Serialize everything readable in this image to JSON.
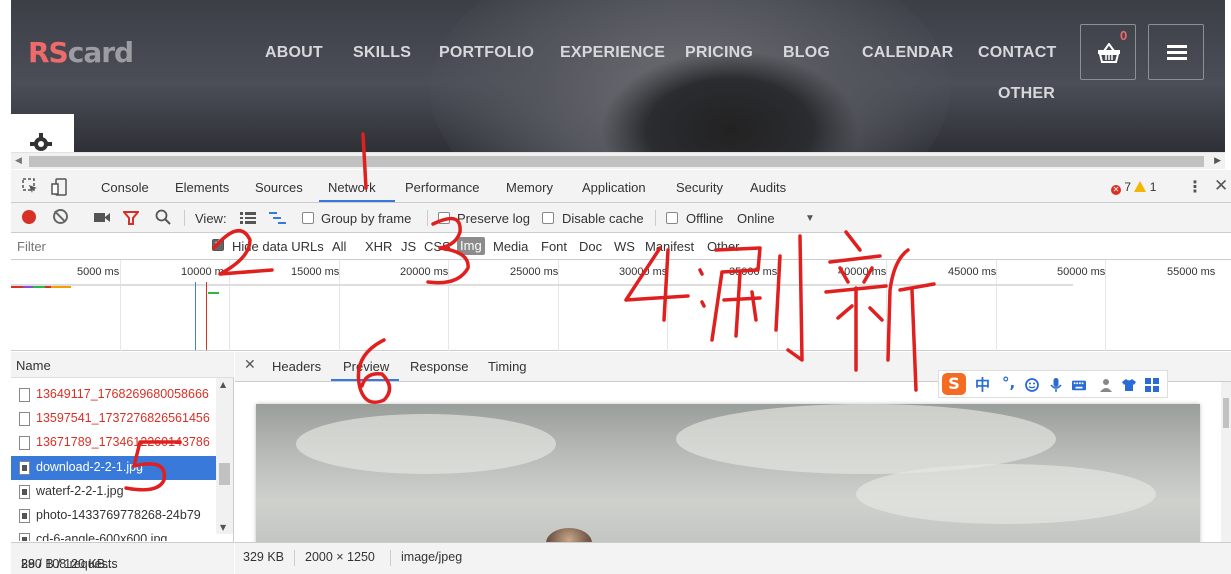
{
  "site": {
    "logo_rs": "RS",
    "logo_card": "card",
    "nav": [
      "ABOUT",
      "SKILLS",
      "PORTFOLIO",
      "EXPERIENCE",
      "PRICING",
      "BLOG",
      "CALENDAR",
      "CONTACT"
    ],
    "nav_other": "OTHER",
    "cart_count": "0",
    "icons": {
      "cart": "basket-icon",
      "menu": "hamburger-menu-icon",
      "settings": "gear-icon"
    }
  },
  "devtools": {
    "tabs": [
      "Console",
      "Elements",
      "Sources",
      "Network",
      "Performance",
      "Memory",
      "Application",
      "Security",
      "Audits"
    ],
    "active_tab": "Network",
    "errors": "7",
    "warnings": "1",
    "toolbar": {
      "view_label": "View:",
      "group_by_frame": "Group by frame",
      "preserve_log": "Preserve log",
      "disable_cache": "Disable cache",
      "offline": "Offline",
      "online": "Online"
    },
    "filter": {
      "placeholder": "Filter",
      "hide_data_urls": "Hide data URLs",
      "types": [
        "All",
        "XHR",
        "JS",
        "CSS",
        "Img",
        "Media",
        "Font",
        "Doc",
        "WS",
        "Manifest",
        "Other"
      ],
      "selected_type": "Img"
    },
    "timeline_labels": [
      "5000 ms",
      "10000 ms",
      "15000 ms",
      "20000 ms",
      "25000 ms",
      "30000 ms",
      "35000 ms",
      "40000 ms",
      "45000 ms",
      "50000 ms",
      "55000 ms"
    ],
    "names_header": "Name",
    "requests": [
      {
        "name": "13649117_1768269680058666",
        "status": "error"
      },
      {
        "name": "13597541_1737276826561456",
        "status": "error"
      },
      {
        "name": "13671789_1734612260143786",
        "status": "error"
      },
      {
        "name": "download-2-2-1.jpg",
        "status": "selected"
      },
      {
        "name": "waterf-2-2-1.jpg",
        "status": "ok"
      },
      {
        "name": "photo-1433769778268-24b79",
        "status": "ok"
      },
      {
        "name": "cd-6-angle-600x600.jpg",
        "status": "ok"
      }
    ],
    "summary": "39 / 108 requests",
    "summary_sep": "I",
    "transfer": "280 B / 120 KB...",
    "detail_tabs": [
      "Headers",
      "Preview",
      "Response",
      "Timing"
    ],
    "detail_active": "Preview",
    "image_info": {
      "size": "329 KB",
      "dimensions": "2000 × 1250",
      "mime": "image/jpeg"
    }
  },
  "ime": {
    "logo": "S",
    "chinese": "中",
    "punct": "°,"
  },
  "annotations": [
    "1",
    "2",
    "3",
    "4:刷新",
    "5",
    "6"
  ],
  "colors": {
    "record": "#d93025",
    "accent": "#3879d9",
    "logo_rs": "#ef6a6a",
    "ime": "#f36c21"
  }
}
